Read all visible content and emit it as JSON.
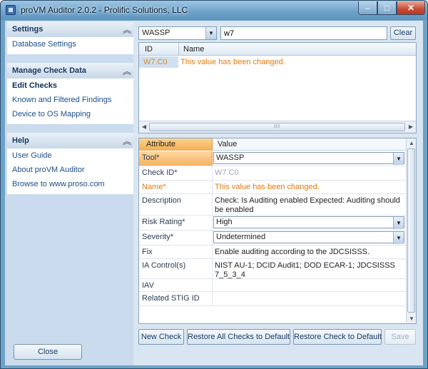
{
  "window": {
    "title": "proVM Auditor 2.0.2 - Prolific Solutions, LLC",
    "caption_buttons": {
      "minimize": "–",
      "maximize": "□",
      "close": "✕"
    }
  },
  "sidebar": {
    "sections": [
      {
        "title": "Settings",
        "items": [
          {
            "label": "Database Settings"
          }
        ]
      },
      {
        "title": "Manage Check Data",
        "items": [
          {
            "label": "Edit Checks",
            "active": true
          },
          {
            "label": "Known and Filtered Findings"
          },
          {
            "label": "Device to OS Mapping"
          }
        ]
      },
      {
        "title": "Help",
        "items": [
          {
            "label": "User Guide"
          },
          {
            "label": "About proVM Auditor"
          },
          {
            "label": "Browse to www.proso.com"
          }
        ]
      }
    ],
    "collapse_icon": "double-chevron-up-icon",
    "close_label": "Close"
  },
  "toolbar": {
    "tool_select": "WASSP",
    "search_value": "w7",
    "clear_label": "Clear"
  },
  "checks_grid": {
    "columns": [
      "ID",
      "Name"
    ],
    "rows": [
      {
        "id": "W7.C0",
        "name": "This value has been changed."
      }
    ],
    "scroll_grip": "III"
  },
  "property_grid": {
    "header": {
      "attribute": "Attribute",
      "value": "Value"
    },
    "rows": [
      {
        "attribute": "Tool*",
        "value": "WASSP"
      },
      {
        "attribute": "Check ID*",
        "value": "W7.C0"
      },
      {
        "attribute": "Name*",
        "value": "This value has been changed."
      },
      {
        "attribute": "Description",
        "value": "Check: Is Auditing enabled Expected: Auditing should be enabled"
      },
      {
        "attribute": "Risk Rating*",
        "value": "High"
      },
      {
        "attribute": "Severity*",
        "value": "Undetermined"
      },
      {
        "attribute": "Fix",
        "value": "Enable auditing according to the JDCSISSS."
      },
      {
        "attribute": "IA Control(s)",
        "value": "NIST AU-1; DCID Audit1; DOD ECAR-1; JDCSISSS 7_5_3_4"
      },
      {
        "attribute": "IAV",
        "value": ""
      },
      {
        "attribute": "Related STIG ID",
        "value": ""
      }
    ]
  },
  "actions": {
    "new_check": "New Check",
    "restore_all": "Restore All Checks to Default",
    "restore_check": "Restore Check to Default",
    "save": "Save"
  },
  "colors": {
    "accent_orange": "#e07a10",
    "selection_orange": "#f6b262",
    "chrome_blue": "#6da2c6"
  }
}
